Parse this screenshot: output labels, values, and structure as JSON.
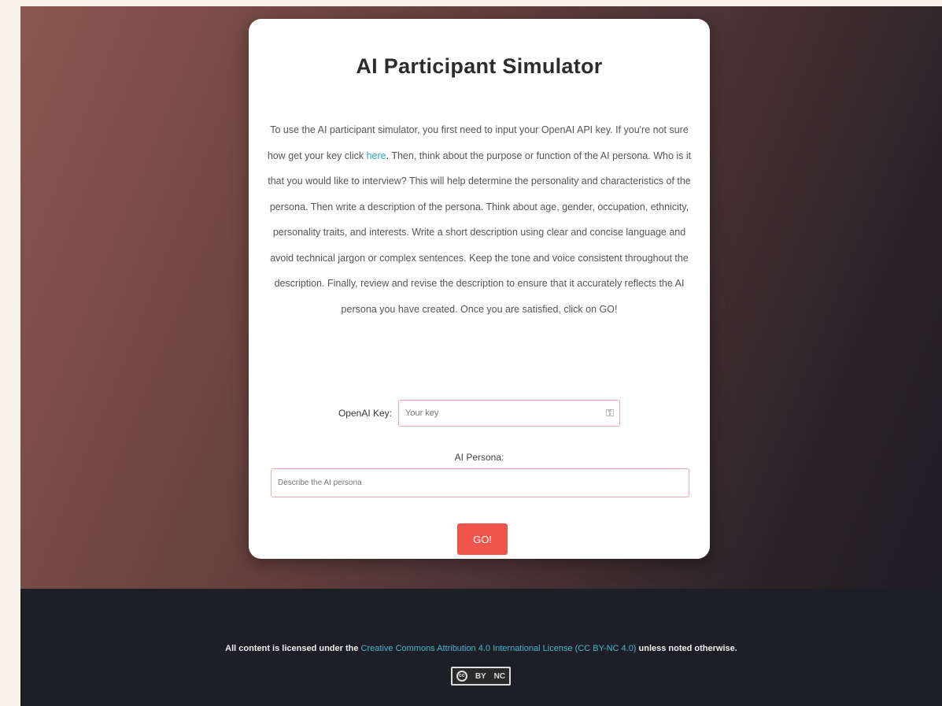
{
  "card": {
    "title": "AI Participant Simulator",
    "description_before_link": "To use the AI participant simulator, you first need to input your OpenAI API key. If you're not sure how get your key click ",
    "description_link": "here",
    "description_after_link": ". Then, think about the purpose or function of the AI persona. Who is it that you would like to interview? This will help determine the personality and characteristics of the persona. Then write a description of the persona. Think about age, gender, occupation, ethnicity, personality traits, and interests. Write a short description using clear and concise language and avoid technical jargon or complex sentences. Keep the tone and voice consistent throughout the description. Finally, review and revise the description to ensure that it accurately reflects the AI persona you have created. Once you are satisfied, click on GO!"
  },
  "form": {
    "key_label": "OpenAI Key:",
    "key_placeholder": "Your key",
    "persona_label": "AI Persona:",
    "persona_placeholder": "Describe the AI persona",
    "go_label": "GO!"
  },
  "footer": {
    "text_before": "All content is licensed under the ",
    "license_link": "Creative Commons Attribution 4.0 International License (CC BY-NC 4.0)",
    "text_after": " unless noted otherwise.",
    "badge_cc": "cc",
    "badge_by": "BY",
    "badge_nc": "NC"
  },
  "colors": {
    "accent": "#f0544a",
    "link": "#2aa8c4",
    "footer_bg": "#1e1f26"
  }
}
